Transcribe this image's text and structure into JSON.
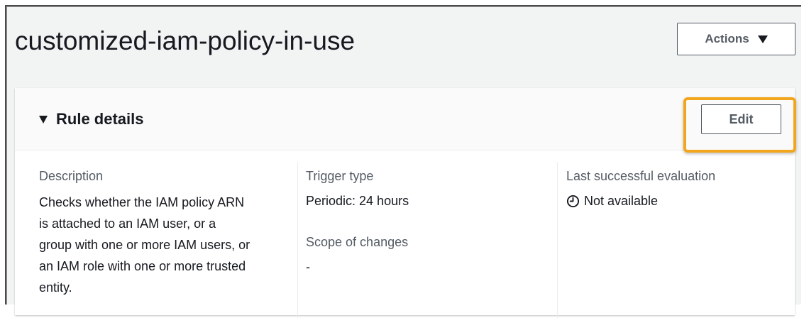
{
  "page": {
    "title": "customized-iam-policy-in-use"
  },
  "actions_button": {
    "label": "Actions",
    "icon": "caret-down-icon"
  },
  "rule_details": {
    "title": "Rule details",
    "toggle_icon": "triangle-down-icon",
    "edit_label": "Edit",
    "highlight_color": "#f2a61d",
    "description": {
      "label": "Description",
      "value": "Checks whether the IAM policy ARN is attached to an IAM user, or a group with one or more IAM users, or an IAM role with one or more trusted entity."
    },
    "trigger_type": {
      "label": "Trigger type",
      "value": "Periodic: 24 hours"
    },
    "scope_of_changes": {
      "label": "Scope of changes",
      "value": "-"
    },
    "last_successful_evaluation": {
      "label": "Last successful evaluation",
      "value": "Not available",
      "icon": "clock-icon"
    }
  }
}
